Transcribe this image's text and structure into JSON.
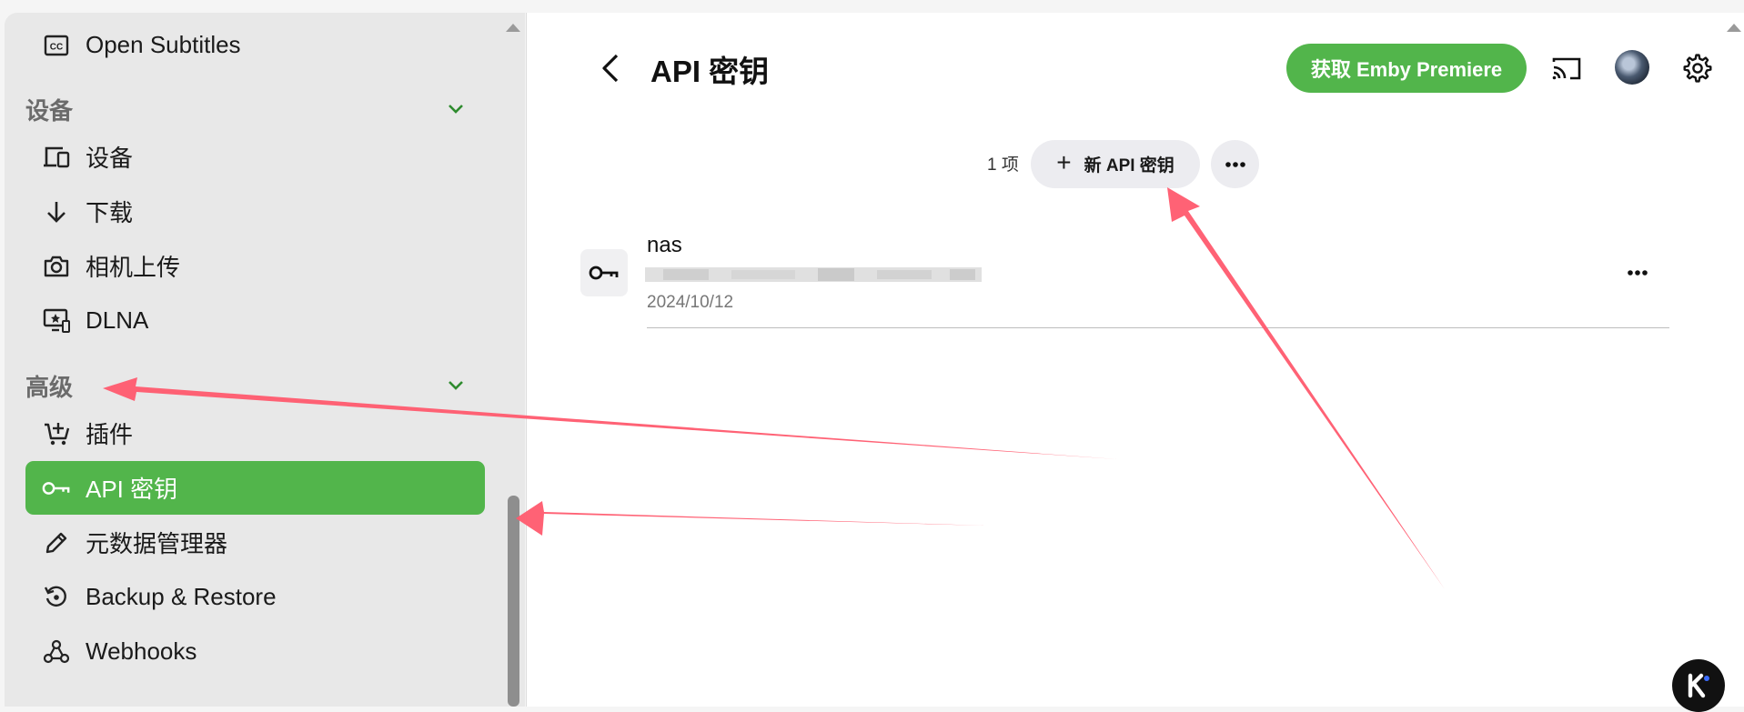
{
  "sidebar": {
    "items_top": [
      {
        "label": "Open Subtitles",
        "icon": "closed-captions-icon"
      }
    ],
    "sections": [
      {
        "title": "设备",
        "items": [
          {
            "label": "设备",
            "icon": "devices-icon"
          },
          {
            "label": "下载",
            "icon": "arrow-down-icon"
          },
          {
            "label": "相机上传",
            "icon": "camera-icon"
          },
          {
            "label": "DLNA",
            "icon": "dlna-icon"
          }
        ]
      },
      {
        "title": "高级",
        "items": [
          {
            "label": "插件",
            "icon": "cart-plus-icon"
          },
          {
            "label": "API 密钥",
            "icon": "key-icon",
            "active": true
          },
          {
            "label": "元数据管理器",
            "icon": "pencil-icon"
          },
          {
            "label": "Backup & Restore",
            "icon": "restore-icon"
          },
          {
            "label": "Webhooks",
            "icon": "webhook-icon"
          }
        ]
      }
    ]
  },
  "header": {
    "title": "API 密钥",
    "premiere_button": "获取 Emby Premiere"
  },
  "toolbar": {
    "count": "1 项",
    "new_button": "新 API 密钥"
  },
  "keys": [
    {
      "name": "nas",
      "date": "2024/10/12"
    }
  ],
  "colors": {
    "accent": "#52b54b",
    "annotation_arrow": "#ff5a6e"
  }
}
